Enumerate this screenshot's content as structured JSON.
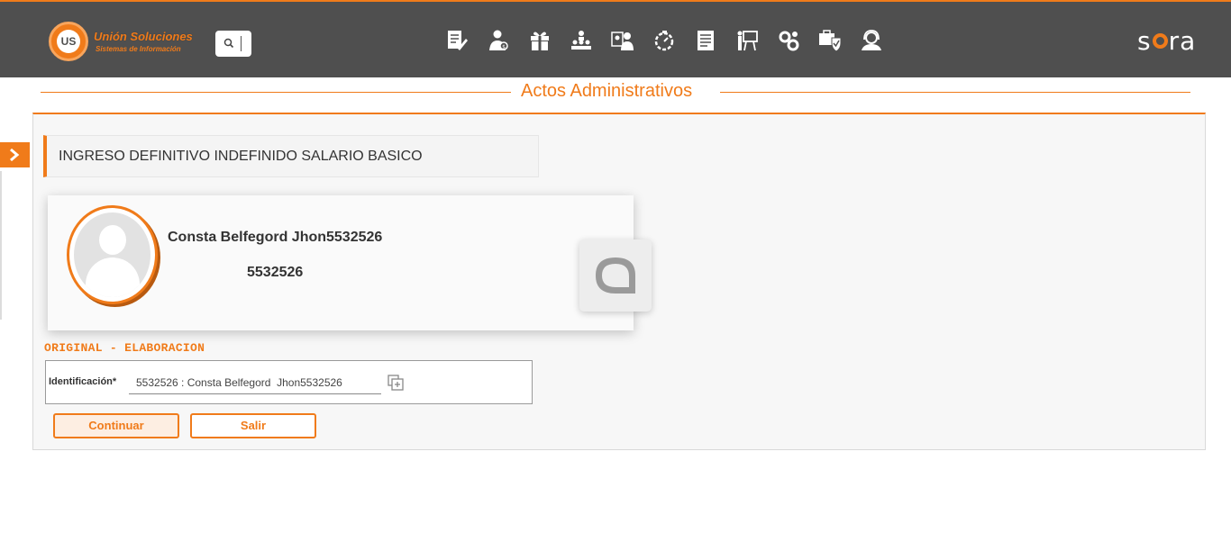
{
  "header": {
    "logo": {
      "mark": "US",
      "name": "Unión Soluciones",
      "tagline": "Sistemas de Información"
    },
    "search": {
      "icon": "search-icon"
    },
    "nav_icons": [
      "edit-document-icon",
      "user-money-icon",
      "gift-icon",
      "org-hierarchy-icon",
      "user-card-icon",
      "stopwatch-icon",
      "document-list-icon",
      "presentation-icon",
      "gears-icon",
      "shield-check-icon",
      "support-agent-icon"
    ],
    "brand": {
      "pre": "s",
      "post": "ra"
    }
  },
  "page": {
    "title": "Actos Administrativos"
  },
  "act": {
    "type": "INGRESO DEFINITIVO INDEFINIDO SALARIO BASICO"
  },
  "employee": {
    "name": "Consta Belfegord Jhon5532526",
    "id": "5532526"
  },
  "status": "ORIGINAL - ELABORACION",
  "form": {
    "id_label": "Identificación*",
    "id_value": "5532526 : Consta Belfegord  Jhon5532526"
  },
  "buttons": {
    "continue": "Continuar",
    "exit": "Salir"
  },
  "colors": {
    "accent": "#f07b1a",
    "topbar": "#4f4f4f"
  }
}
